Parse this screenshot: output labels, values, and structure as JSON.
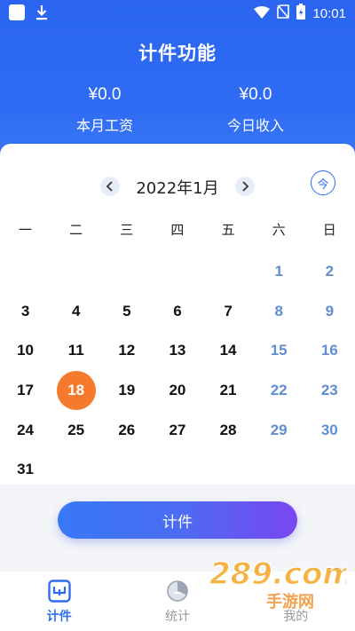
{
  "status_bar": {
    "time": "10:01"
  },
  "header": {
    "title": "计件功能",
    "monthly_wage": {
      "value": "¥0.0",
      "label": "本月工资"
    },
    "today_income": {
      "value": "¥0.0",
      "label": "今日收入"
    }
  },
  "calendar": {
    "month_label": "2022年1月",
    "today_button": "今",
    "weekdays": [
      "一",
      "二",
      "三",
      "四",
      "五",
      "六",
      "日"
    ],
    "days": [
      "",
      "",
      "",
      "",
      "",
      "1",
      "2",
      "3",
      "4",
      "5",
      "6",
      "7",
      "8",
      "9",
      "10",
      "11",
      "12",
      "13",
      "14",
      "15",
      "16",
      "17",
      "18",
      "19",
      "20",
      "21",
      "22",
      "23",
      "24",
      "25",
      "26",
      "27",
      "28",
      "29",
      "30",
      "31",
      "",
      "",
      "",
      "",
      "",
      ""
    ],
    "selected_day": "18"
  },
  "action": {
    "count_button": "计件"
  },
  "tabs": [
    {
      "label": "计件",
      "icon": "piece-count-icon",
      "active": true
    },
    {
      "label": "统计",
      "icon": "pie-chart-icon",
      "active": false
    },
    {
      "label": "我的",
      "icon": "user-icon",
      "active": false
    }
  ],
  "watermark": {
    "text": "289.com",
    "subtext": "手游网"
  },
  "colors": {
    "primary": "#2f6cf3",
    "selected": "#f57a2b",
    "weekend": "#5f8fd0"
  }
}
